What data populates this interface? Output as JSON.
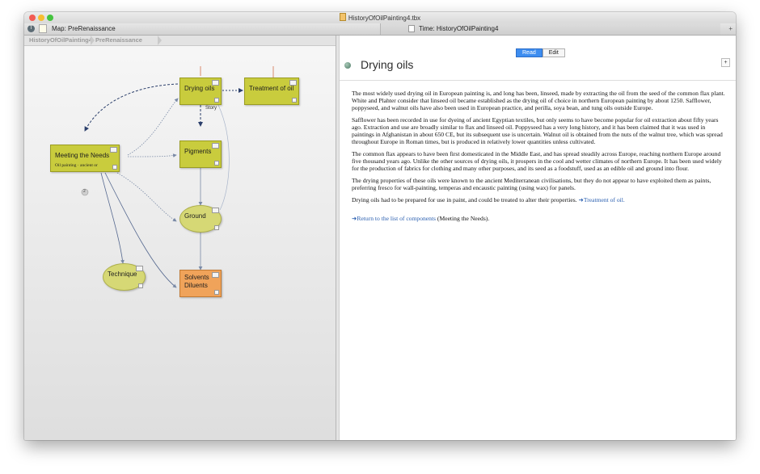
{
  "window": {
    "title": "HistoryOfOilPainting4.tbx",
    "colors": {
      "close": "#f25c54",
      "minimize": "#f7be31",
      "zoom": "#45c33f"
    }
  },
  "tabs": {
    "map": {
      "label": "Map: PreRenaissance"
    },
    "text": {
      "label": "Time: HistoryOfOilPainting4"
    },
    "add_label": "+"
  },
  "breadcrumbs": [
    "HistoryOfOilPainting4",
    "PreRenaissance"
  ],
  "map": {
    "notes": {
      "drying_oils": {
        "title": "Drying oils"
      },
      "treatment": {
        "title": "Treatment of oil"
      },
      "meeting": {
        "title": "Meeting the Needs",
        "subtitle": "Oil painting · ancient or"
      },
      "pigments": {
        "title": "Pigments"
      },
      "ground": {
        "title": "Ground"
      },
      "technique": {
        "title": "Technique"
      },
      "solvents": {
        "title": "Solvents\nDiluents",
        "line1": "Solvents",
        "line2": "Diluents"
      }
    },
    "link_label": "Story",
    "badge": "2"
  },
  "text_pane": {
    "mode": {
      "read": "Read",
      "edit": "Edit",
      "active": "Read"
    },
    "note_title": "Drying oils",
    "plus_label": "+",
    "paragraphs": [
      "The most widely used drying oil in European painting is, and long has been, linseed, made by extracting the oil from the seed of the common flax plant. White and Plahter consider that linseed oil became established as the drying oil of choice in northern European painting by about 1250. Safflower, poppyseed, and walnut oils have also been used in European practice, and perilla, soya bean, and tung oils outside Europe.",
      "Safflower has been recorded in use for dyeing of ancient Egyptian textiles, but only seems to have become popular for oil extraction about fifty years ago. Extraction and use are broadly similar to flax and linseed oil. Poppyseed has a very long history, and it has been claimed that it was used in paintings in Afghanistan in about 650 CE, but its subsequent use is uncertain. Walnut oil is obtained from the nuts of the walnut tree, which was spread throughout Europe in Roman times, but is produced in relatively lower quantities unless cultivated.",
      "The common flax appears to have been first domesticated in the Middle East, and has spread steadily across Europe, reaching northern Europe around five thousand years ago. Unlike the other sources of drying oils, it prospers in the cool and wetter climates of northern Europe. It has been used widely for the production of fabrics for clothing and many other purposes, and its seed as a foodstuff, used as an edible oil and ground into flour.",
      "The drying properties of these oils were known to the ancient Mediterranean civilisations, but they do not appear to have exploited them as paints, preferring fresco for wall-painting, temperas and encaustic painting (using wax) for panels."
    ],
    "last_paragraph": {
      "text": "Drying oils had to be prepared for use in paint, and could be treated to alter their properties. ",
      "link": "➜Treatment of oil."
    },
    "return_link": {
      "link": "➜Return to the list of components",
      "tail": " (Meeting the Needs)."
    }
  }
}
